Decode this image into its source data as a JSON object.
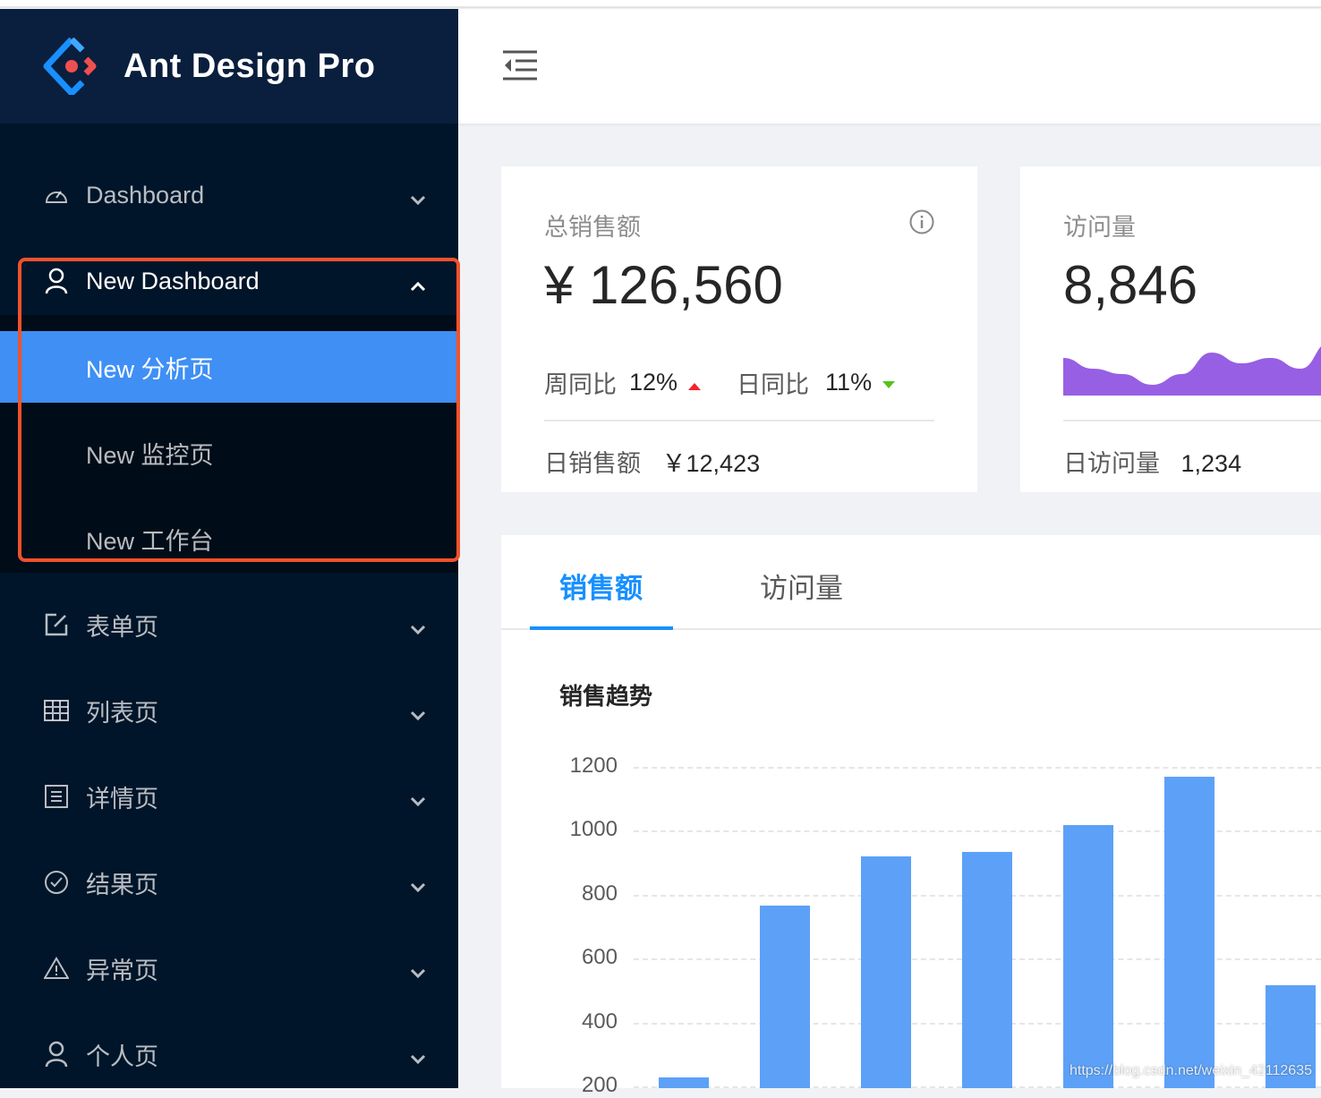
{
  "app": {
    "title": "Ant Design Pro"
  },
  "sidebar": {
    "items": [
      {
        "label": "Dashboard",
        "icon": "dashboard-icon",
        "expanded": false
      },
      {
        "label": "New Dashboard",
        "icon": "user-icon",
        "expanded": true,
        "children": [
          {
            "label": "New 分析页",
            "active": true
          },
          {
            "label": "New 监控页"
          },
          {
            "label": "New 工作台"
          }
        ]
      },
      {
        "label": "表单页",
        "icon": "form-icon"
      },
      {
        "label": "列表页",
        "icon": "table-icon"
      },
      {
        "label": "详情页",
        "icon": "profile-icon"
      },
      {
        "label": "结果页",
        "icon": "check-circle-icon"
      },
      {
        "label": "异常页",
        "icon": "warning-icon"
      },
      {
        "label": "个人页",
        "icon": "user-icon"
      }
    ]
  },
  "cards": {
    "sales": {
      "label": "总销售额",
      "value": "¥ 126,560",
      "wow_label": "周同比",
      "wow": "12%",
      "wow_trend": "up",
      "dod_label": "日同比",
      "dod": "11%",
      "dod_trend": "down",
      "footer_label": "日销售额",
      "footer_value": "￥12,423"
    },
    "visits": {
      "label": "访问量",
      "value": "8,846",
      "footer_label": "日访问量",
      "footer_value": "1,234",
      "area_color": "#975fe4",
      "trend": [
        7,
        5,
        4,
        2,
        4,
        8,
        6,
        7,
        5,
        10,
        6
      ]
    }
  },
  "tabs": [
    {
      "label": "销售额",
      "active": true
    },
    {
      "label": "访问量"
    }
  ],
  "chart_data": {
    "type": "bar",
    "title": "销售趋势",
    "yticks": [
      "1200",
      "1000",
      "800",
      "600",
      "400",
      "200"
    ],
    "values": [
      228,
      765,
      919,
      933,
      1017,
      1168,
      516
    ],
    "ylim": [
      0,
      1200
    ],
    "grid": true,
    "color": "#5ca1f7"
  },
  "colors": {
    "primary": "#1890ff",
    "sider": "#001529",
    "up": "#f5222d",
    "down": "#52c41a"
  },
  "watermark": "https://blog.csdn.net/weixin_42112635"
}
